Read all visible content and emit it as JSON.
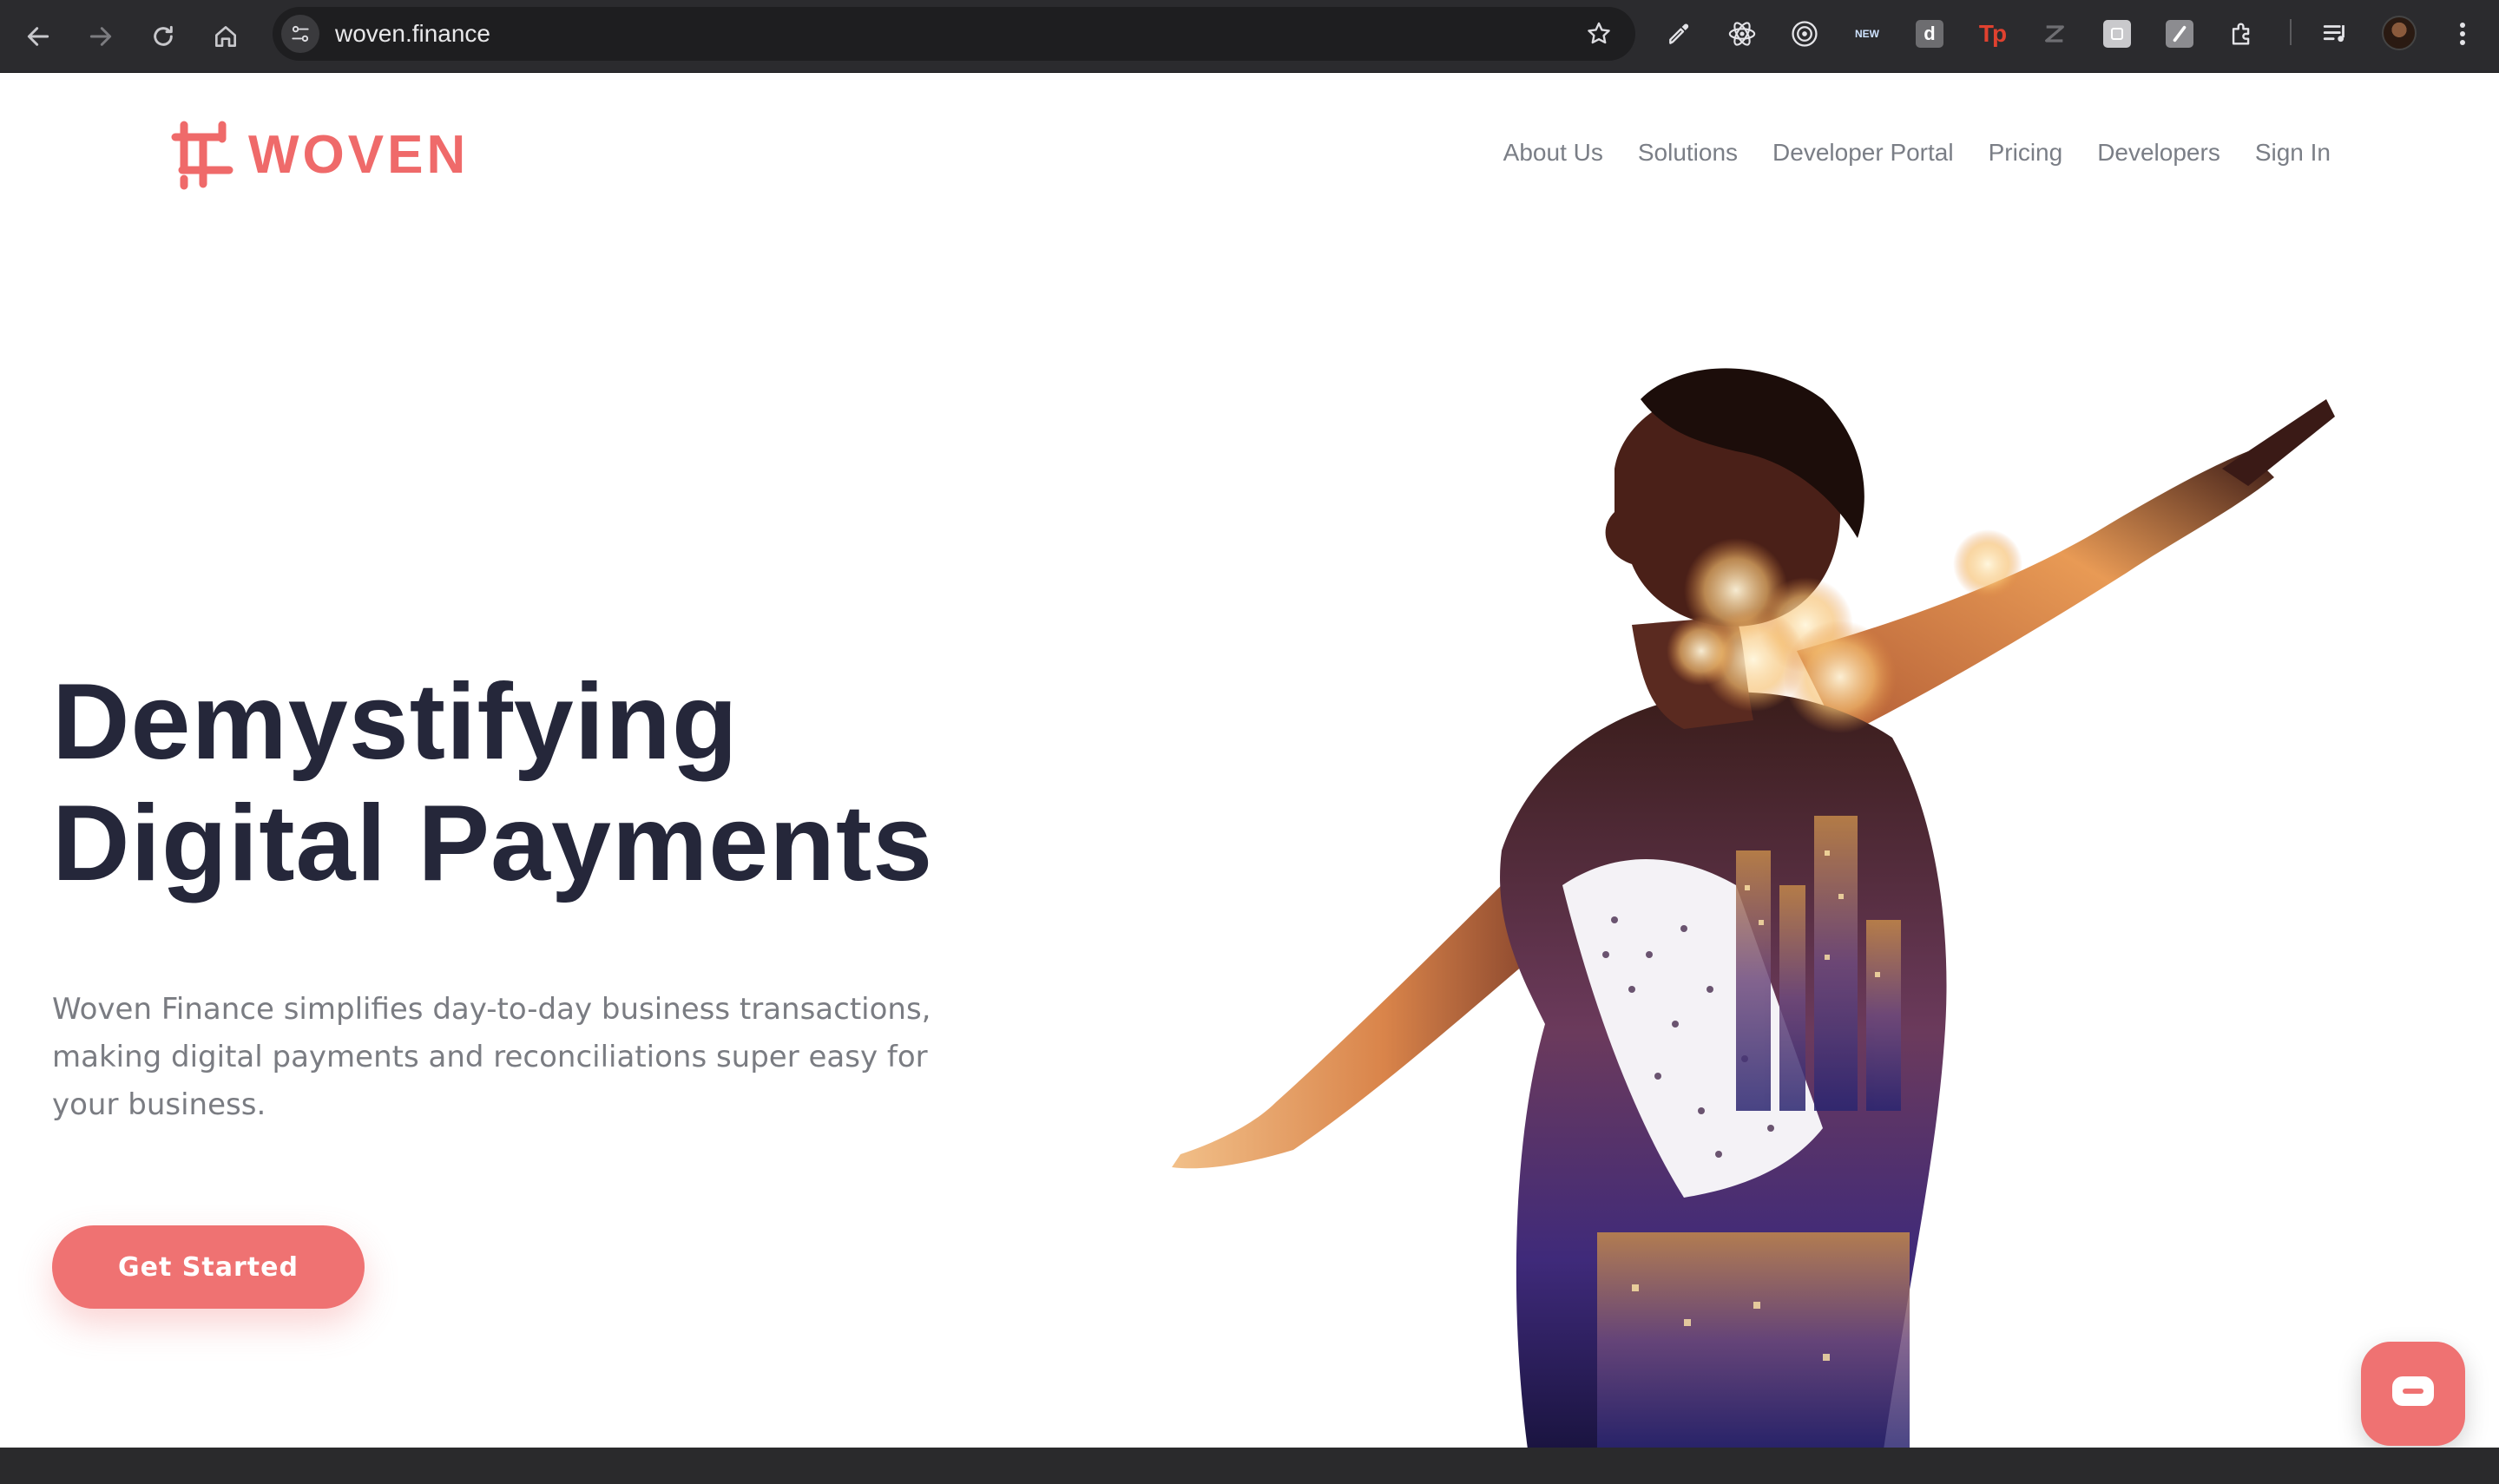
{
  "browser": {
    "url": "woven.finance",
    "extensions": [
      {
        "name": "eyedropper-icon"
      },
      {
        "name": "react-devtools-icon"
      },
      {
        "name": "target-icon"
      },
      {
        "name": "new-badge-icon",
        "text": "NEW"
      },
      {
        "name": "d-extension-icon",
        "text": "d"
      },
      {
        "name": "tp-extension-icon",
        "text": "Tp"
      },
      {
        "name": "z-extension-icon"
      },
      {
        "name": "square-extension-icon"
      },
      {
        "name": "slash-extension-icon"
      },
      {
        "name": "puzzle-icon"
      },
      {
        "name": "playlist-icon"
      }
    ]
  },
  "site": {
    "brand": "WOVEN",
    "brand_color": "#ef6a6a",
    "nav": [
      "About Us",
      "Solutions",
      "Developer Portal",
      "Pricing",
      "Developers",
      "Sign In"
    ]
  },
  "hero": {
    "title_line1": "Demystifying",
    "title_line2": "Digital Payments",
    "subtitle_line1": "Woven Finance simplifies day-to-day business transactions,",
    "subtitle_line2": "making digital payments and reconciliations super easy for",
    "subtitle_line3": "your business.",
    "cta": "Get Started",
    "cta_color": "#ef7272"
  }
}
